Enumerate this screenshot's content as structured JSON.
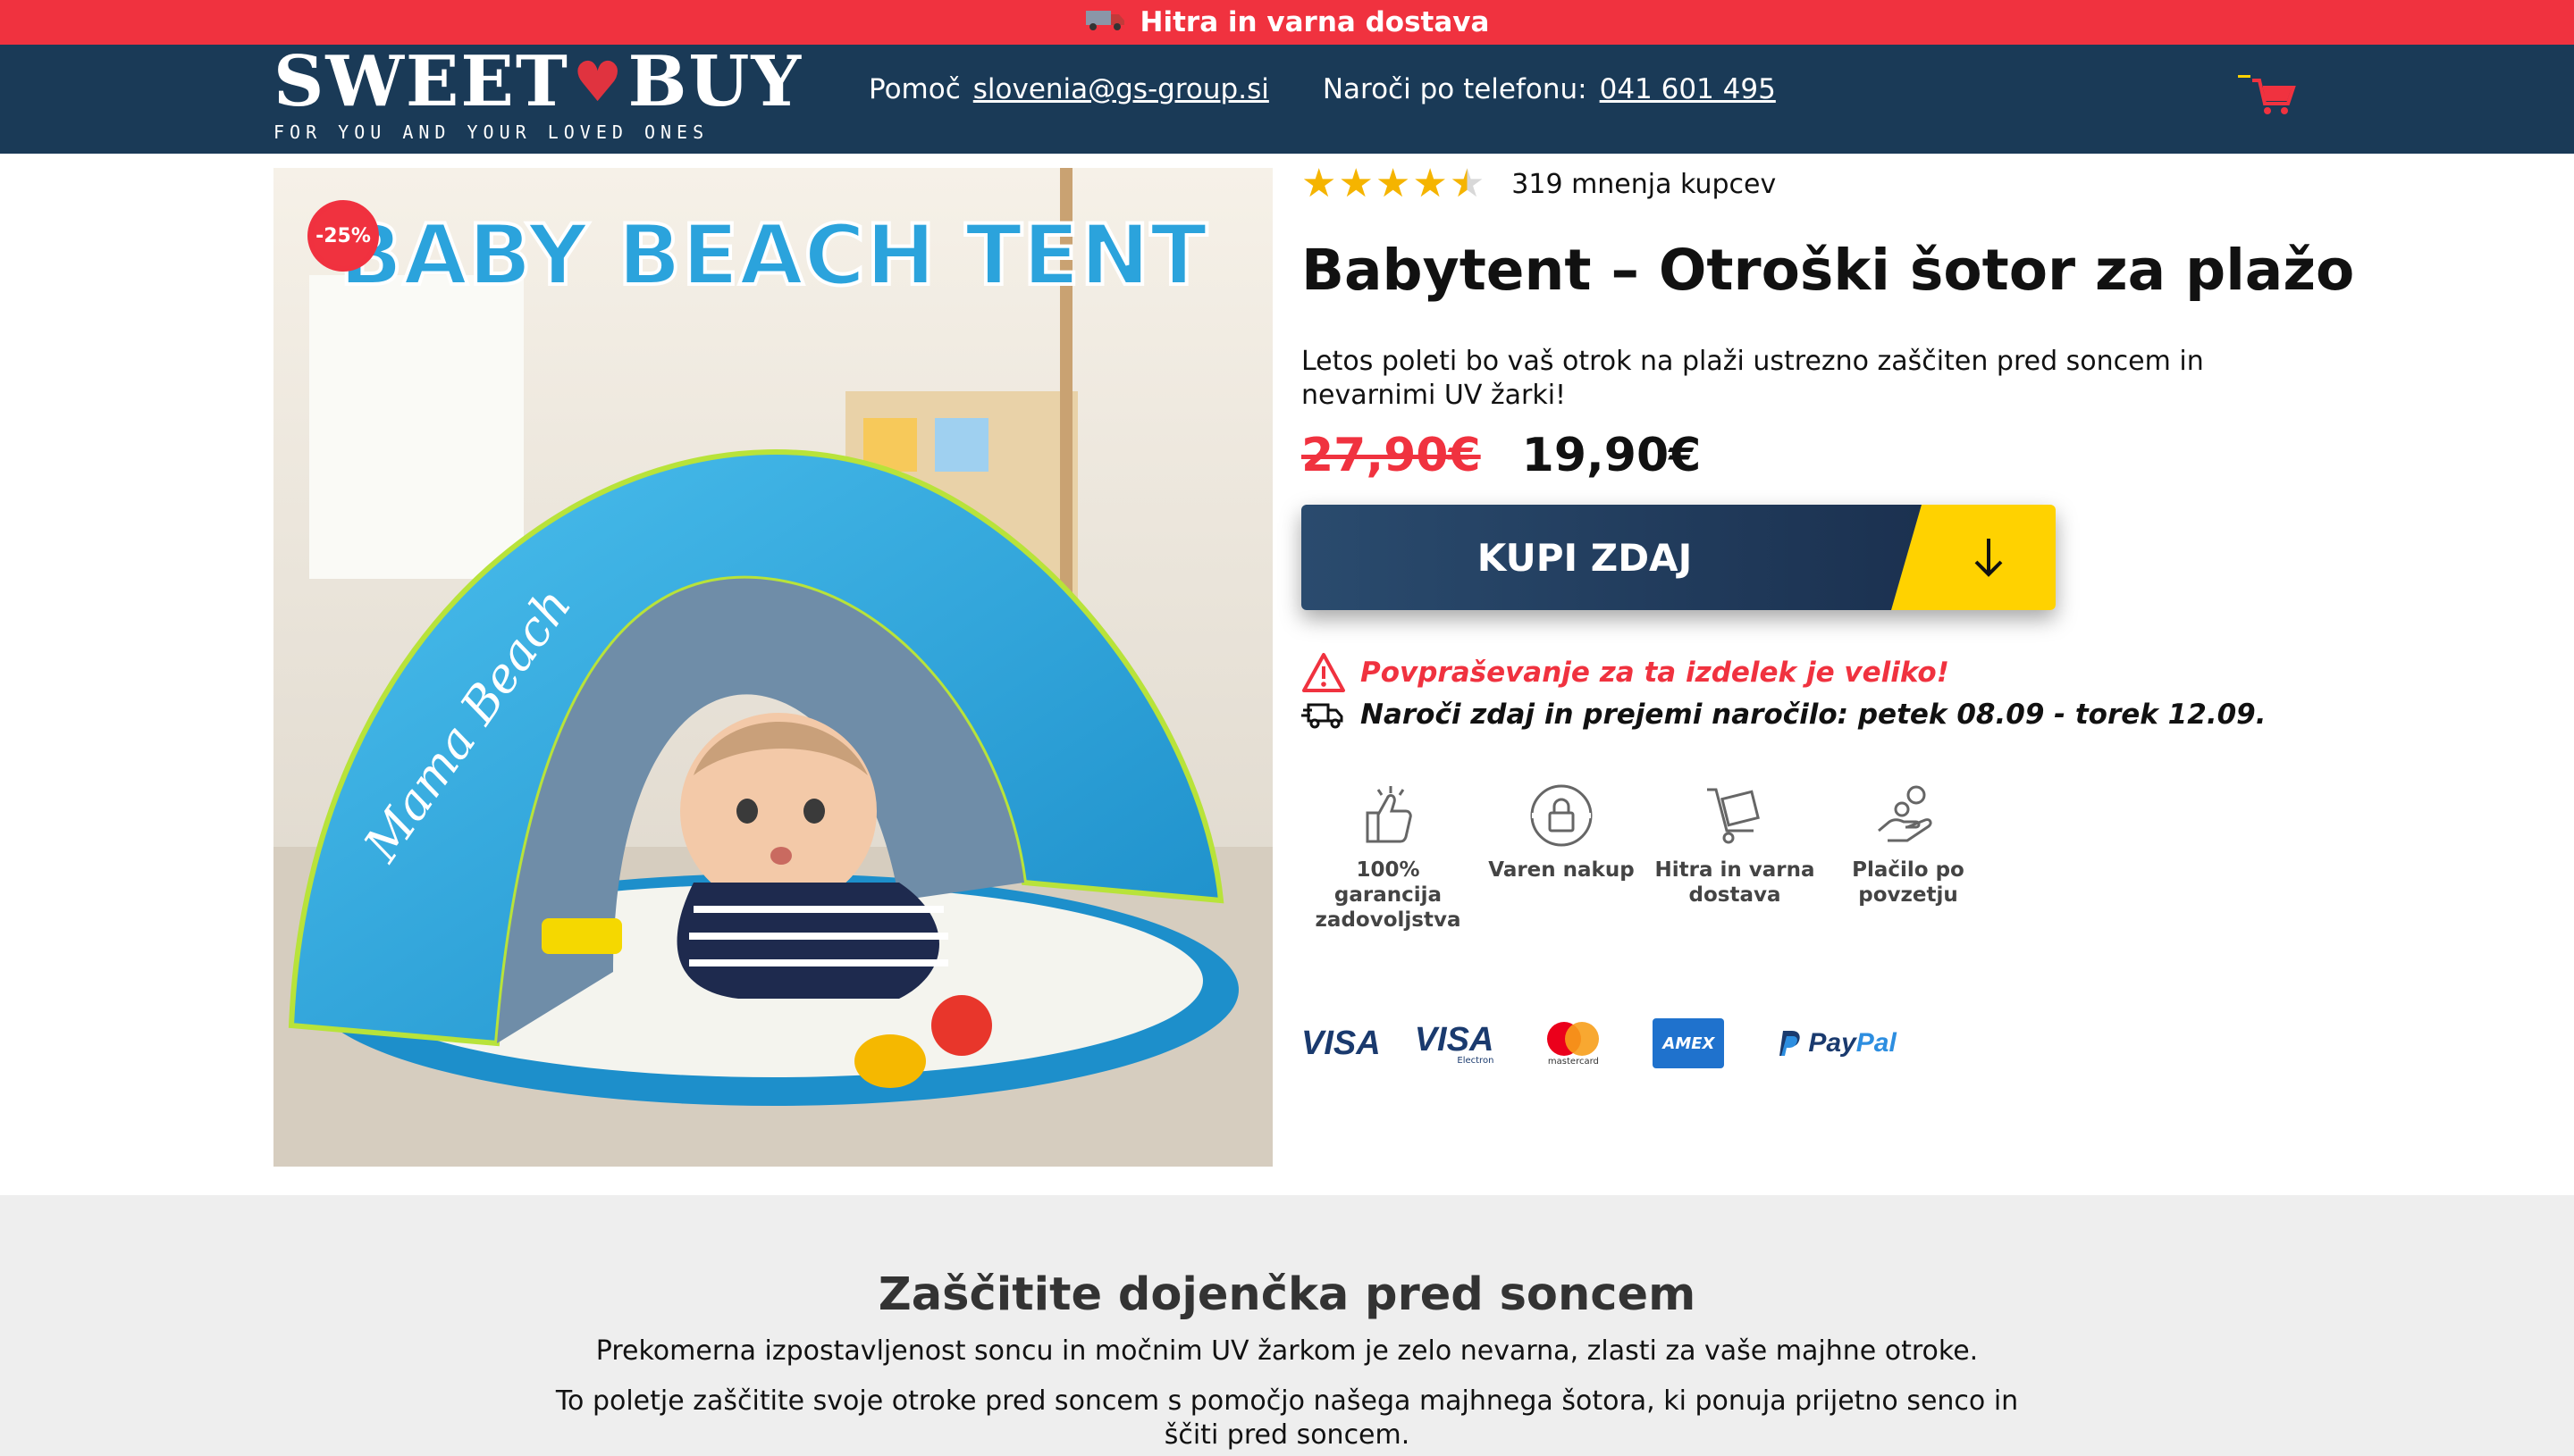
{
  "topbar": {
    "text": "Hitra in varna dostava"
  },
  "header": {
    "logo_text": "SWEET",
    "logo_text2": "BUY",
    "logo_tagline": "FOR YOU AND YOUR LOVED ONES",
    "help_label": "Pomoč",
    "help_email": "slovenia@gs-group.si",
    "phone_label": "Naroči po telefonu:",
    "phone_number": "041 601 495"
  },
  "product": {
    "discount_badge": "-25%",
    "image_title": "BABY BEACH TENT",
    "image_brand": "Mama Beach",
    "rating_value": 4.5,
    "reviews": "319 mnenja kupcev",
    "title": "Babytent – Otroški šotor za plažo",
    "description": "Letos poleti bo vaš otrok na plaži ustrezno zaščiten pred soncem in nevarnimi UV žarki!",
    "old_price": "27,90€",
    "new_price": "19,90€",
    "buy_label": "KUPI ZDAJ",
    "warning": "Povpraševanje za ta izdelek je veliko!",
    "shipping": "Naroči zdaj in prejemi naročilo: petek 08.09 - torek 12.09."
  },
  "features": [
    {
      "icon": "thumbs-up-icon",
      "label": "100% garancija zadovoljstva"
    },
    {
      "icon": "lock-icon",
      "label": "Varen nakup"
    },
    {
      "icon": "delivery-cart-icon",
      "label": "Hitra in varna dostava"
    },
    {
      "icon": "cash-hand-icon",
      "label": "Plačilo po povzetju"
    }
  ],
  "payments": {
    "visa": "VISA",
    "visa_electron": "VISA",
    "visa_electron_sub": "Electron",
    "mastercard_sub": "mastercard",
    "amex": "AMEX",
    "paypal_1": "Pay",
    "paypal_2": "Pal"
  },
  "info": {
    "heading": "Zaščitite dojenčka pred soncem",
    "p1": "Prekomerna izpostavljenost soncu in močnim UV žarkom je zelo nevarna, zlasti za vaše majhne otroke.",
    "p2": "To poletje zaščitite svoje otroke pred soncem s pomočjo našega majhnega šotora, ki ponuja prijetno senco in ščiti pred soncem."
  },
  "colors": {
    "red": "#f0323f",
    "navy": "#1a3a57",
    "yellow": "#ffd200",
    "star": "#f5b400",
    "tent_blue": "#2ba3dc"
  }
}
